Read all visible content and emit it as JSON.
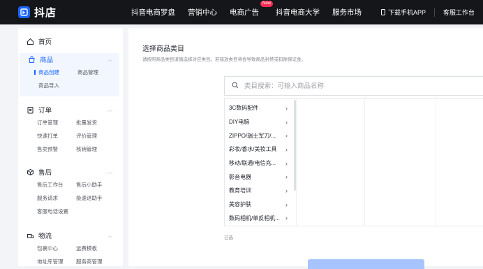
{
  "app": {
    "logo_text": "抖店"
  },
  "topnav": {
    "items": [
      "抖音电商罗盘",
      "营销中心",
      "电商广告",
      "抖音电商大学",
      "服务市场"
    ],
    "badge": "New",
    "download": "下载手机APP",
    "service": "客服工作台"
  },
  "sidebar": {
    "home": "首页",
    "goods": {
      "label": "商品",
      "subs": [
        "商品创建",
        "商品管理",
        "商品导入"
      ]
    },
    "orders": {
      "label": "订单",
      "subs": [
        "订单管理",
        "批量发货",
        "快速打单",
        "评价管理",
        "售卖预警",
        "核销管理"
      ]
    },
    "aftersale": {
      "label": "售后",
      "subs": [
        "售后工作台",
        "售后小助手",
        "服务请求",
        "极速退助手",
        "客服电话设置"
      ]
    },
    "logistics": {
      "label": "物流",
      "subs": [
        "包裹中心",
        "运费模板",
        "地址库管理",
        "服务商管理"
      ]
    }
  },
  "main": {
    "title": "选择商品类目",
    "desc": "请按照商品类目谨慎选择对应类目。若错放类目将会导致商品封禁或扣除保证金。",
    "search_placeholder": "类目搜索：可输入商品名称",
    "categories": [
      "3C数码配件",
      "DIY电脑",
      "ZIPPO/瑞士军刀/...",
      "彩妆/香水/美妆工具",
      "移动/联通/电信充...",
      "影音电器",
      "教育培训",
      "美容护肤",
      "数码相机/单反相机..."
    ],
    "selected_label": "已选"
  },
  "colors": {
    "accent": "#1966ff",
    "topbar": "#141619",
    "badge": "#fe2c55"
  }
}
